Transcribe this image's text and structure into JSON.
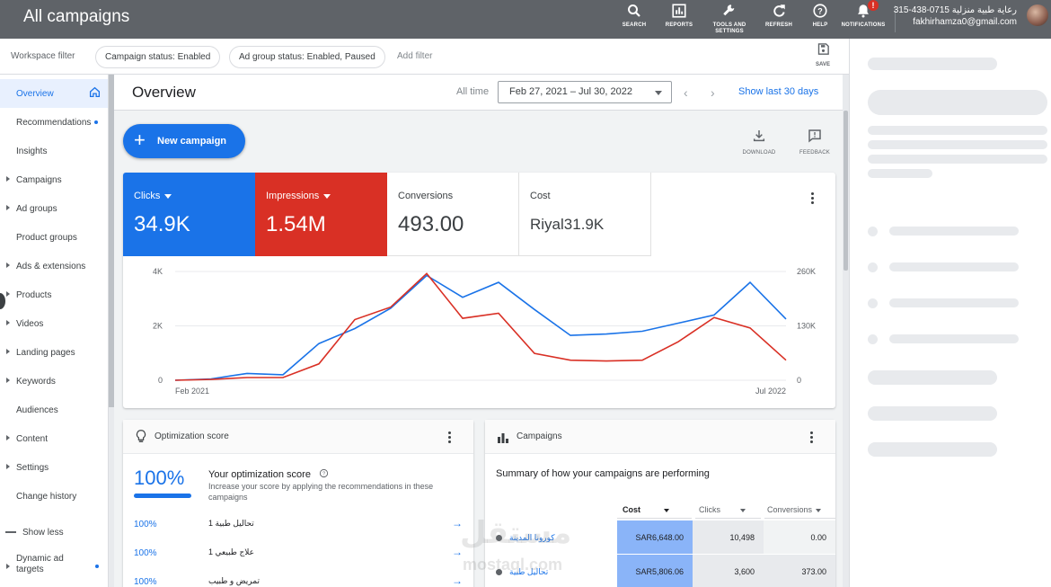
{
  "topbar": {
    "title": "All campaigns",
    "icons": [
      {
        "label": "SEARCH",
        "icon": "search-icon"
      },
      {
        "label": "REPORTS",
        "icon": "reports-icon"
      },
      {
        "label": "TOOLS AND SETTINGS",
        "icon": "wrench-icon"
      },
      {
        "label": "REFRESH",
        "icon": "refresh-icon"
      },
      {
        "label": "HELP",
        "icon": "help-icon"
      },
      {
        "label": "NOTIFICATIONS",
        "icon": "bell-icon"
      }
    ],
    "notification_badge": "!",
    "account_name": "315-438-0715 رعاية طبية منزلية",
    "account_email": "fakhirhamza0@gmail.com"
  },
  "filters": {
    "workspace": "Workspace filter",
    "chips": [
      "Campaign status: Enabled",
      "Ad group status: Enabled, Paused"
    ],
    "add": "Add filter",
    "save": "SAVE"
  },
  "sidebar": {
    "items": [
      {
        "label": "Overview",
        "active": true,
        "caret": false,
        "dot": false
      },
      {
        "label": "Recommendations",
        "active": false,
        "caret": false,
        "dot": true
      },
      {
        "label": "Insights",
        "active": false,
        "caret": false,
        "dot": false
      },
      {
        "label": "Campaigns",
        "active": false,
        "caret": true,
        "dot": false
      },
      {
        "label": "Ad groups",
        "active": false,
        "caret": true,
        "dot": false
      },
      {
        "label": "Product groups",
        "active": false,
        "caret": false,
        "dot": false
      },
      {
        "label": "Ads & extensions",
        "active": false,
        "caret": true,
        "dot": false
      },
      {
        "label": "Products",
        "active": false,
        "caret": true,
        "dot": false
      },
      {
        "label": "Videos",
        "active": false,
        "caret": true,
        "dot": false
      },
      {
        "label": "Landing pages",
        "active": false,
        "caret": true,
        "dot": false
      },
      {
        "label": "Keywords",
        "active": false,
        "caret": true,
        "dot": false
      },
      {
        "label": "Audiences",
        "active": false,
        "caret": false,
        "dot": false
      },
      {
        "label": "Content",
        "active": false,
        "caret": true,
        "dot": false
      },
      {
        "label": "Settings",
        "active": false,
        "caret": true,
        "dot": false
      },
      {
        "label": "Change history",
        "active": false,
        "caret": false,
        "dot": false
      }
    ],
    "show_less": "Show less",
    "dynamic": "Dynamic ad targets"
  },
  "overview": {
    "title": "Overview",
    "all_time": "All time",
    "date_range": "Feb 27, 2021 – Jul 30, 2022",
    "show_last": "Show last 30 days",
    "new_campaign": "New campaign",
    "download": "DOWNLOAD",
    "feedback": "FEEDBACK"
  },
  "metrics": [
    {
      "name": "Clicks",
      "value": "34.9K",
      "color": "#1a73e8",
      "dropdown": true
    },
    {
      "name": "Impressions",
      "value": "1.54M",
      "color": "#d93025",
      "dropdown": true
    },
    {
      "name": "Conversions",
      "value": "493.00",
      "color": "#ffffff",
      "dropdown": false
    },
    {
      "name": "Cost",
      "value": "Riyal31.9K",
      "color": "#ffffff",
      "dropdown": false
    }
  ],
  "chart_data": {
    "type": "line",
    "x_start_label": "Feb 2021",
    "x_end_label": "Jul 2022",
    "left_ticks": [
      "4K",
      "2K",
      "0"
    ],
    "right_ticks": [
      "260K",
      "130K",
      "0"
    ],
    "ylim_left": [
      0,
      4000
    ],
    "ylim_right": [
      0,
      260000
    ],
    "grid": true,
    "series": [
      {
        "name": "Clicks",
        "color": "#1a73e8",
        "axis": "left",
        "values": [
          0,
          50,
          250,
          200,
          1350,
          1900,
          2650,
          3850,
          3050,
          3600,
          2600,
          1650,
          1700,
          1800,
          2100,
          2400,
          3600,
          2250
        ]
      },
      {
        "name": "Impressions",
        "color": "#d93025",
        "axis": "right",
        "values": [
          0,
          2000,
          6500,
          6500,
          39000,
          145000,
          175000,
          255000,
          148000,
          160000,
          64000,
          48000,
          46000,
          48000,
          92000,
          150000,
          125000,
          48000
        ]
      }
    ]
  },
  "optimization": {
    "title": "Optimization score",
    "score": "100%",
    "heading": "Your optimization score",
    "desc": "Increase your score by applying the recommendations in these campaigns",
    "rows": [
      {
        "pct": "100%",
        "name": "تحاليل طبية 1"
      },
      {
        "pct": "100%",
        "name": "علاج طبيعي 1"
      },
      {
        "pct": "100%",
        "name": "تمريض و طبيب"
      }
    ]
  },
  "campaigns_card": {
    "title": "Campaigns",
    "subtitle": "Summary of how your campaigns are performing",
    "headers": [
      "Cost",
      "Clicks",
      "Conversions"
    ],
    "rows": [
      {
        "name": "كورونا المدينة",
        "cost": "SAR6,648.00",
        "clicks": "10,498",
        "conversions": "0.00"
      },
      {
        "name": "تحاليل طبية",
        "cost": "SAR5,806.06",
        "clicks": "3,600",
        "conversions": "373.00"
      }
    ]
  },
  "watermark": {
    "text": "مستقل",
    "sub": "mostaql.com"
  }
}
